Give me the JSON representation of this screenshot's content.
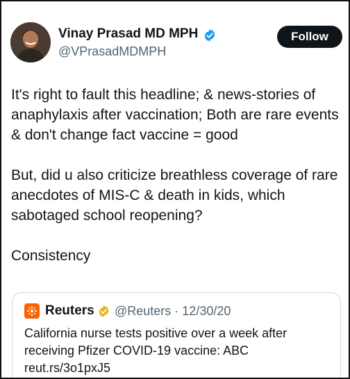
{
  "author": {
    "name": "Vinay Prasad MD MPH",
    "handle": "@VPrasadMDMPH",
    "avatar_icon": "avatar-photo",
    "verified_badge_color": "#1d9bf0"
  },
  "follow_button": {
    "label": "Follow"
  },
  "tweet": {
    "paragraphs": [
      "It's right to fault this headline; & news-stories of anaphylaxis after vaccination; Both are rare events & don't change fact vaccine = good",
      "But, did u also criticize breathless coverage of rare anecdotes of MIS-C & death in kids, which sabotaged school reopening?",
      "Consistency"
    ]
  },
  "quoted_tweet": {
    "name": "Reuters",
    "meta": "@Reuters · 12/30/20",
    "logo_icon": "reuters-logo",
    "badge_color": "#e2b719",
    "text": "California nurse tests positive over a week after receiving Pfizer COVID-19 vaccine: ABC reut.rs/3o1pxJ5"
  }
}
